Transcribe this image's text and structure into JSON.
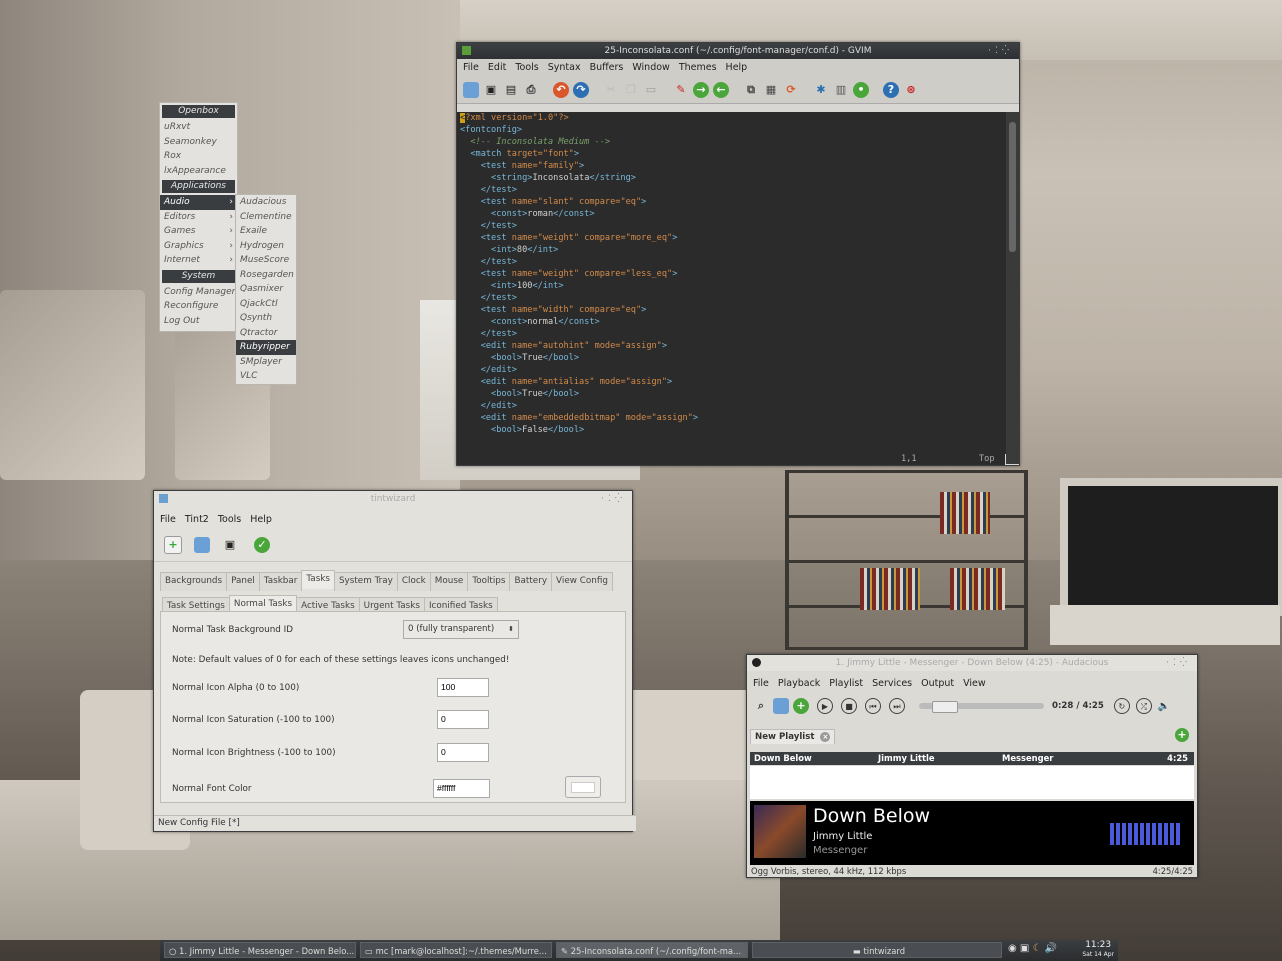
{
  "openbox_menu": {
    "header": "Openbox",
    "items": [
      "uRxvt",
      "Seamonkey",
      "Rox",
      "lxAppearance"
    ],
    "applications_header": "Applications",
    "categories": [
      {
        "label": "Audio",
        "selected": true
      },
      {
        "label": "Editors"
      },
      {
        "label": "Games"
      },
      {
        "label": "Graphics"
      },
      {
        "label": "Internet"
      }
    ],
    "system_header": "System",
    "system_items": [
      "Config Manager",
      "Reconfigure",
      "Log Out"
    ],
    "audio_submenu": [
      "Audacious",
      "Clementine",
      "Exaile",
      "Hydrogen",
      "MuseScore",
      "Rosegarden",
      "Qasmixer",
      "QjackCtl",
      "Qsynth",
      "Qtractor",
      "Rubyripper",
      "SMplayer",
      "VLC"
    ],
    "audio_selected": "Rubyripper"
  },
  "gvim": {
    "title": "25-Inconsolata.conf (~/.config/font-manager/conf.d) - GVIM",
    "menu": [
      "File",
      "Edit",
      "Tools",
      "Syntax",
      "Buffers",
      "Window",
      "Themes",
      "Help"
    ],
    "status_pos": "1,1",
    "status_scroll": "Top",
    "lines": [
      "<?xml version=\"1.0\"?>",
      "<fontconfig>",
      "  <!-- Inconsolata Medium -->",
      "  <match target=\"font\">",
      "    <test name=\"family\">",
      "      <string>Inconsolata</string>",
      "    </test>",
      "    <test name=\"slant\" compare=\"eq\">",
      "      <const>roman</const>",
      "    </test>",
      "    <test name=\"weight\" compare=\"more_eq\">",
      "      <int>80</int>",
      "    </test>",
      "    <test name=\"weight\" compare=\"less_eq\">",
      "      <int>100</int>",
      "    </test>",
      "    <test name=\"width\" compare=\"eq\">",
      "      <const>normal</const>",
      "    </test>",
      "    <edit name=\"autohint\" mode=\"assign\">",
      "      <bool>True</bool>",
      "    </edit>",
      "    <edit name=\"antialias\" mode=\"assign\">",
      "      <bool>True</bool>",
      "    </edit>",
      "    <edit name=\"embeddedbitmap\" mode=\"assign\">",
      "      <bool>False</bool>"
    ]
  },
  "tint": {
    "title": "tintwizard",
    "menu": [
      "File",
      "Tint2",
      "Tools",
      "Help"
    ],
    "tabs": [
      "Backgrounds",
      "Panel",
      "Taskbar",
      "Tasks",
      "System Tray",
      "Clock",
      "Mouse",
      "Tooltips",
      "Battery",
      "View Config"
    ],
    "active_tab": "Tasks",
    "subtabs": [
      "Task Settings",
      "Normal Tasks",
      "Active Tasks",
      "Urgent Tasks",
      "Iconified Tasks"
    ],
    "active_subtab": "Normal Tasks",
    "bg_label": "Normal Task Background ID",
    "bg_value": "0 (fully transparent)",
    "note": "Note: Default values of 0 for each of these settings leaves icons unchanged!",
    "alpha_label": "Normal Icon Alpha (0 to 100)",
    "alpha_value": "100",
    "saturation_label": "Normal Icon Saturation (-100 to 100)",
    "saturation_value": "0",
    "brightness_label": "Normal Icon Brightness (-100 to 100)",
    "brightness_value": "0",
    "font_color_label": "Normal Font Color",
    "font_color_value": "#ffffff",
    "status": "New Config File [*]"
  },
  "audacious": {
    "title": "1. Jimmy Little - Messenger - Down Below (4:25) - Audacious",
    "menu": [
      "File",
      "Playback",
      "Playlist",
      "Services",
      "Output",
      "View"
    ],
    "time": "0:28 / 4:25",
    "seek_fraction": 0.106,
    "playlist_tab": "New Playlist",
    "columns": {
      "title": "Down Below",
      "artist": "Jimmy Little",
      "album": "Messenger",
      "length": "4:25"
    },
    "now_title": "Down Below",
    "now_artist": "Jimmy Little",
    "now_album": "Messenger",
    "status_left": "Ogg Vorbis, stereo, 44 kHz, 112 kbps",
    "status_right": "4:25/4:25"
  },
  "taskbar": {
    "tasks": [
      "1. Jimmy Little - Messenger - Down Belo...",
      "mc [mark@localhost]:~/.themes/Murre...",
      "25-Inconsolata.conf (~/.config/font-ma...",
      "tintwizard"
    ],
    "clock_time": "11:23",
    "clock_date": "Sat 14 Apr"
  }
}
